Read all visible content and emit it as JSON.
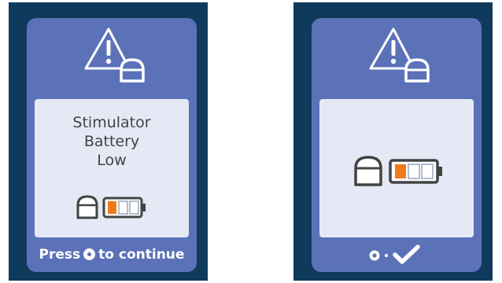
{
  "colors": {
    "bezel": "#103a5c",
    "card": "#5b72b9",
    "panel": "#e4e9f5",
    "text_dark": "#434343",
    "text_light": "#ffffff",
    "battery_low": "#f07a1a",
    "battery_empty": "#f2f4f8"
  },
  "left_screen": {
    "warning_icon": "warning-triangle-with-stimulator-icon",
    "message_lines": [
      "Stimulator",
      "Battery",
      "Low"
    ],
    "stimulator_icon": "stimulator-icon",
    "battery_icon": "battery-low-icon",
    "battery_level_bars": 1,
    "battery_total_bars": 3,
    "footer_prefix": "Press",
    "footer_button_icon": "select-button-icon",
    "footer_suffix": "to continue"
  },
  "right_screen": {
    "warning_icon": "warning-triangle-with-stimulator-icon",
    "stimulator_icon": "stimulator-icon",
    "battery_icon": "battery-low-icon",
    "battery_level_bars": 1,
    "battery_total_bars": 3,
    "confirm_button_icon": "select-button-icon",
    "confirm_icon": "checkmark-icon"
  }
}
